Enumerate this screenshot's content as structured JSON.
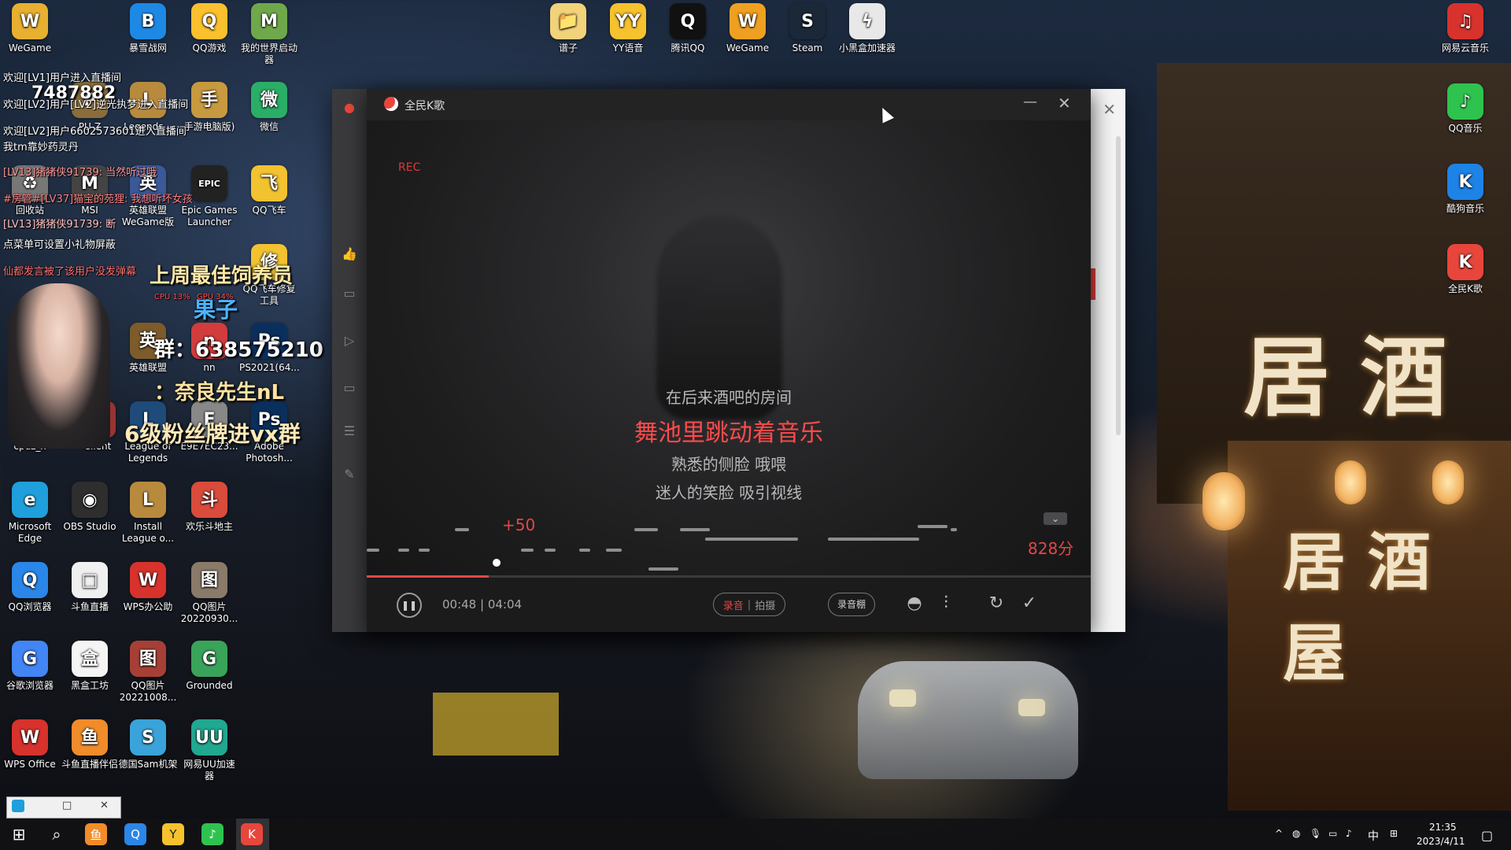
{
  "desktop": {
    "left_column_icons": [
      {
        "label": "WeGame",
        "color": "#e8b030",
        "glyph": "W"
      },
      {
        "label": "暴雪战网",
        "color": "#1e88e5",
        "glyph": "B"
      },
      {
        "label": "QQ游戏",
        "color": "#fbc02d",
        "glyph": "Q"
      },
      {
        "label": "我的世界启动器",
        "color": "#6fa84b",
        "glyph": "M"
      },
      {
        "label": "PU-Z",
        "color": "#8a6d3b",
        "glyph": "P"
      },
      {
        "label": "Legends...",
        "color": "#b88a3d",
        "glyph": "L"
      },
      {
        "label": "手游电脑版)",
        "color": "#c79a40",
        "glyph": "手"
      },
      {
        "label": "微信",
        "color": "#2aae67",
        "glyph": "微"
      },
      {
        "label": "回收站",
        "color": "#777777",
        "glyph": "♻"
      },
      {
        "label": "MSI",
        "color": "#444444",
        "glyph": "M"
      },
      {
        "label": "英雄联盟 WeGame版",
        "color": "#3b5998",
        "glyph": "英"
      },
      {
        "label": "Epic Games Launcher",
        "color": "#222222",
        "glyph": "EPIC"
      },
      {
        "label": "QQ飞车",
        "color": "#f2c230",
        "glyph": "飞"
      },
      {
        "label": "QQ飞车修复工具",
        "color": "#f2c230",
        "glyph": "修"
      },
      {
        "label": "cpuz_x",
        "color": "#5c6b7a",
        "glyph": "C"
      },
      {
        "label": "Client",
        "color": "#9a3232",
        "glyph": "C"
      },
      {
        "label": "League of Legends",
        "color": "#1e4b7a",
        "glyph": "L"
      },
      {
        "label": "E9E7EC23...",
        "color": "#888888",
        "glyph": "E"
      },
      {
        "label": "Adobe Photosh...",
        "color": "#0b2f5c",
        "glyph": "Ps"
      },
      {
        "label": "英雄联盟",
        "color": "#7d5b2a",
        "glyph": "英"
      },
      {
        "label": "nn",
        "color": "#d23c3c",
        "glyph": "n"
      },
      {
        "label": "PS2021(64...",
        "color": "#0b2f5c",
        "glyph": "Ps"
      },
      {
        "label": "Microsoft Edge",
        "color": "#1f9fdb",
        "glyph": "e"
      },
      {
        "label": "OBS Studio",
        "color": "#2e2e2e",
        "glyph": "◉"
      },
      {
        "label": "Install League o...",
        "color": "#b88a3d",
        "glyph": "L"
      },
      {
        "label": "欢乐斗地主",
        "color": "#d94b3b",
        "glyph": "斗"
      },
      {
        "label": "QQ浏览器",
        "color": "#2a86e8",
        "glyph": "Q"
      },
      {
        "label": "斗鱼直播",
        "color": "#f0f0f0",
        "glyph": "□"
      },
      {
        "label": "WPS办公助",
        "color": "#d7322c",
        "glyph": "W"
      },
      {
        "label": "QQ图片 20220930...",
        "color": "#8a7a6a",
        "glyph": "图"
      },
      {
        "label": "谷歌浏览器",
        "color": "#4285f4",
        "glyph": "G"
      },
      {
        "label": "黑盒工坊",
        "color": "#f5f5f5",
        "glyph": "盒"
      },
      {
        "label": "QQ图片 20221008...",
        "color": "#a64036",
        "glyph": "图"
      },
      {
        "label": "Grounded",
        "color": "#3aa35a",
        "glyph": "G"
      },
      {
        "label": "WPS Office",
        "color": "#d7322c",
        "glyph": "W"
      },
      {
        "label": "斗鱼直播伴侣",
        "color": "#f08c2a",
        "glyph": "鱼"
      },
      {
        "label": "德国Sam机架",
        "color": "#3aa3d9",
        "glyph": "S"
      },
      {
        "label": "网易UU加速器",
        "color": "#20a890",
        "glyph": "UU"
      }
    ],
    "top_row_icons": [
      {
        "label": "谱子",
        "color": "#f2d27a",
        "glyph": "📁"
      },
      {
        "label": "YY语音",
        "color": "#f6c22e",
        "glyph": "YY"
      },
      {
        "label": "腾讯QQ",
        "color": "#111111",
        "glyph": "Q"
      },
      {
        "label": "WeGame",
        "color": "#f0a020",
        "glyph": "W"
      },
      {
        "label": "Steam",
        "color": "#1b2838",
        "glyph": "S"
      },
      {
        "label": "小黑盒加速器",
        "color": "#e8e8e8",
        "glyph": "ϟ"
      }
    ],
    "right_column_icons": [
      {
        "label": "网易云音乐",
        "color": "#d8322d",
        "glyph": "♫"
      },
      {
        "label": "QQ音乐",
        "color": "#2ec34f",
        "glyph": "♪"
      },
      {
        "label": "酷狗音乐",
        "color": "#1d83e6",
        "glyph": "K"
      },
      {
        "label": "全民K歌",
        "color": "#e8463c",
        "glyph": "K"
      }
    ],
    "scene_signs": [
      "居 酒",
      "居 酒 屋"
    ],
    "lantern_text": "居酒屋"
  },
  "stream_overlay": {
    "chat_lines": [
      "欢迎[LV1]用户进入直播间",
      "欢迎[LV2]用户[LV2]逆光执梦进入直播间",
      "欢迎[LV2]用户6602573601进入直播间",
      "我tm靠妙药灵丹",
      "[LV13]猪猪侠91739: 当然听过哦",
      "#房管#[LV37]猫宝的苑狸: 我想听坏女孩",
      "[LV13]猪猪侠91739: 断",
      "点菜单可设置小礼物屏蔽",
      "仙都发言被了该用户没发弹幕"
    ],
    "room_number": "7487882",
    "weekly_label": "上周最佳饲养员",
    "weekly_name": "果子",
    "group_label": "群：638575210",
    "douyin_label": "：奈良先生nL",
    "fan_label": "6级粉丝牌进vx群",
    "cpu_label": "CPU 13%",
    "gpu_label": "GPU 34%"
  },
  "karaoke_window": {
    "title": "全民K歌",
    "rec_label": "REC",
    "lyrics": {
      "previous": "在后来酒吧的房间",
      "current": "舞池里跳动着音乐",
      "next1": "熟悉的侧脸 哦喂",
      "next2": "迷人的笑脸 吸引视线"
    },
    "bonus": "+50",
    "score": "828分",
    "progress_fraction": 0.168,
    "time_current": "00:48",
    "time_separator": "|",
    "time_total": "04:04",
    "mode_record": "录音",
    "mode_separator": "|",
    "mode_video": "拍摄",
    "studio_label": "录音棚",
    "pause_symbol": "❚❚",
    "collapse_symbol": "⌄",
    "minimize_symbol": "—",
    "close_symbol": "✕"
  },
  "back_window": {
    "close_symbol": "✕"
  },
  "mini_window": {
    "restore_symbol": "□",
    "close_symbol": "✕"
  },
  "taskbar": {
    "start_symbol": "⊞",
    "search_symbol": "⌕",
    "time": "21:35",
    "date": "2023/4/11",
    "ime_label": "中",
    "tray_up_symbol": "^"
  }
}
